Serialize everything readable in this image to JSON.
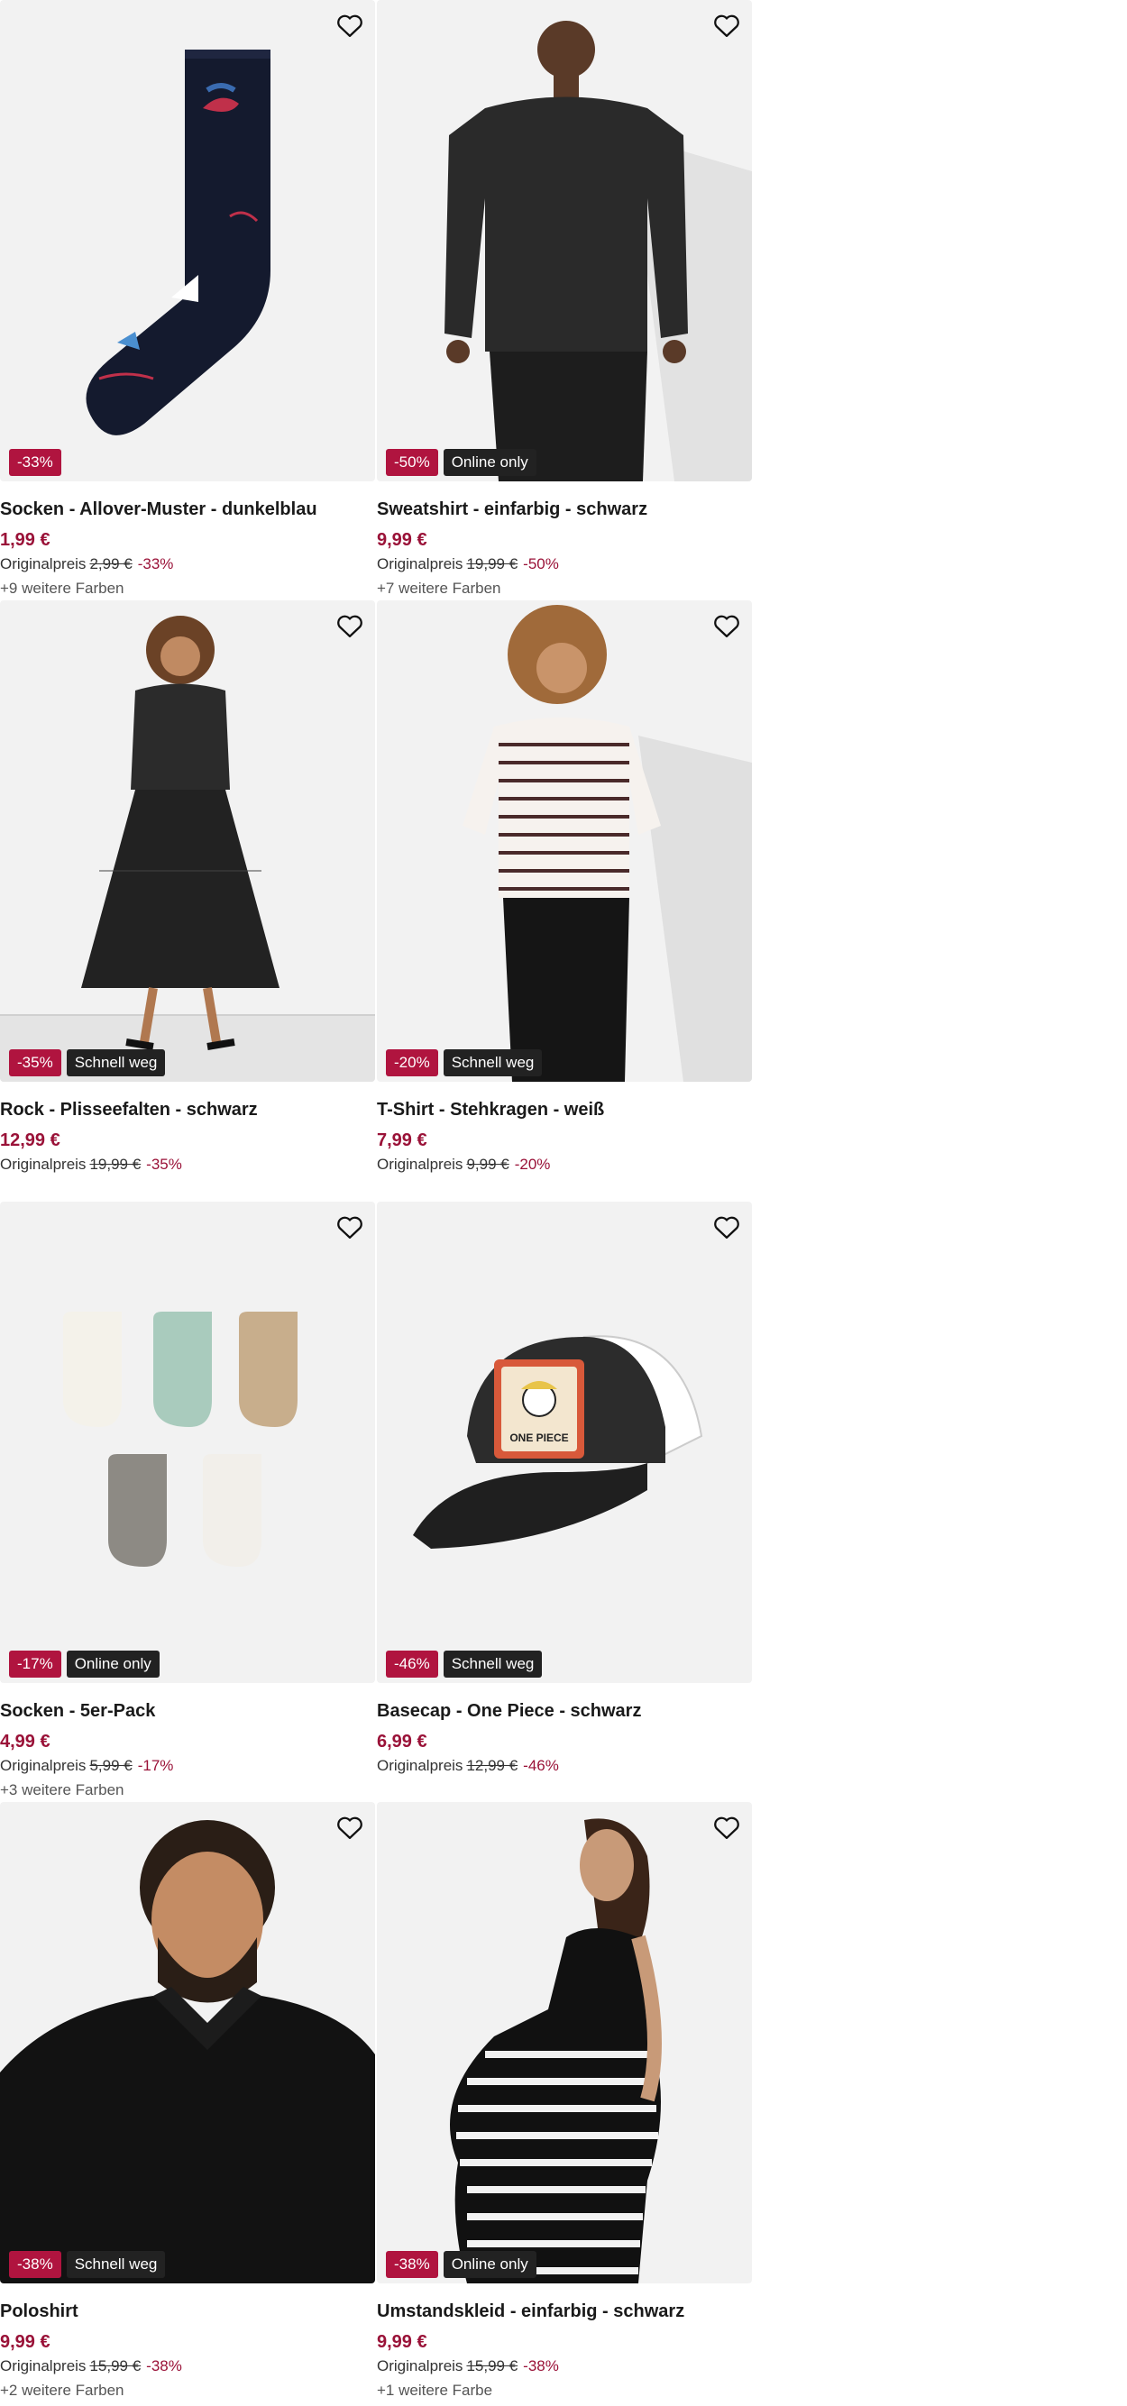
{
  "products": [
    {
      "title": "Socken - Allover-Muster - dunkelblau",
      "price": "1,99 €",
      "original_label": "Originalpreis",
      "original_price": "2,99 €",
      "discount": "-33%",
      "badge": "-33%",
      "tag": "",
      "more_colors": "+9 weitere Farben",
      "image": "sock-navy"
    },
    {
      "title": "Sweatshirt - einfarbig - schwarz",
      "price": "9,99 €",
      "original_label": "Originalpreis",
      "original_price": "19,99 €",
      "discount": "-50%",
      "badge": "-50%",
      "tag": "Online only",
      "more_colors": "+7 weitere Farben",
      "image": "sweatshirt-black"
    },
    {
      "title": "Rock - Plisseefalten - schwarz",
      "price": "12,99 €",
      "original_label": "Originalpreis",
      "original_price": "19,99 €",
      "discount": "-35%",
      "badge": "-35%",
      "tag": "Schnell weg",
      "more_colors": "",
      "image": "pleated-skirt"
    },
    {
      "title": "T-Shirt - Stehkragen - weiß",
      "price": "7,99 €",
      "original_label": "Originalpreis",
      "original_price": "9,99 €",
      "discount": "-20%",
      "badge": "-20%",
      "tag": "Schnell weg",
      "more_colors": "",
      "image": "striped-tshirt"
    },
    {
      "title": "Socken - 5er-Pack",
      "price": "4,99 €",
      "original_label": "Originalpreis",
      "original_price": "5,99 €",
      "discount": "-17%",
      "badge": "-17%",
      "tag": "Online only",
      "more_colors": "+3 weitere Farben",
      "image": "socks-5-pack"
    },
    {
      "title": "Basecap - One Piece - schwarz",
      "price": "6,99 €",
      "original_label": "Originalpreis",
      "original_price": "12,99 €",
      "discount": "-46%",
      "badge": "-46%",
      "tag": "Schnell weg",
      "more_colors": "",
      "image": "cap-one-piece",
      "image_text": "ONE PIECE"
    },
    {
      "title": "Poloshirt",
      "price": "9,99 €",
      "original_label": "Originalpreis",
      "original_price": "15,99 €",
      "discount": "-38%",
      "badge": "-38%",
      "tag": "Schnell weg",
      "more_colors": "+2 weitere Farben",
      "image": "polo-black"
    },
    {
      "title": "Umstandskleid - einfarbig - schwarz",
      "price": "9,99 €",
      "original_label": "Originalpreis",
      "original_price": "15,99 €",
      "discount": "-38%",
      "badge": "-38%",
      "tag": "Online only",
      "more_colors": "+1 weitere Farbe",
      "image": "maternity-dress-striped"
    }
  ],
  "icons": {
    "wishlist": "heart-outline-icon"
  },
  "colors": {
    "price": "#9a1238",
    "discount_badge": "#b0143f",
    "tag_badge": "#222222",
    "image_bg": "#f2f2f2"
  }
}
